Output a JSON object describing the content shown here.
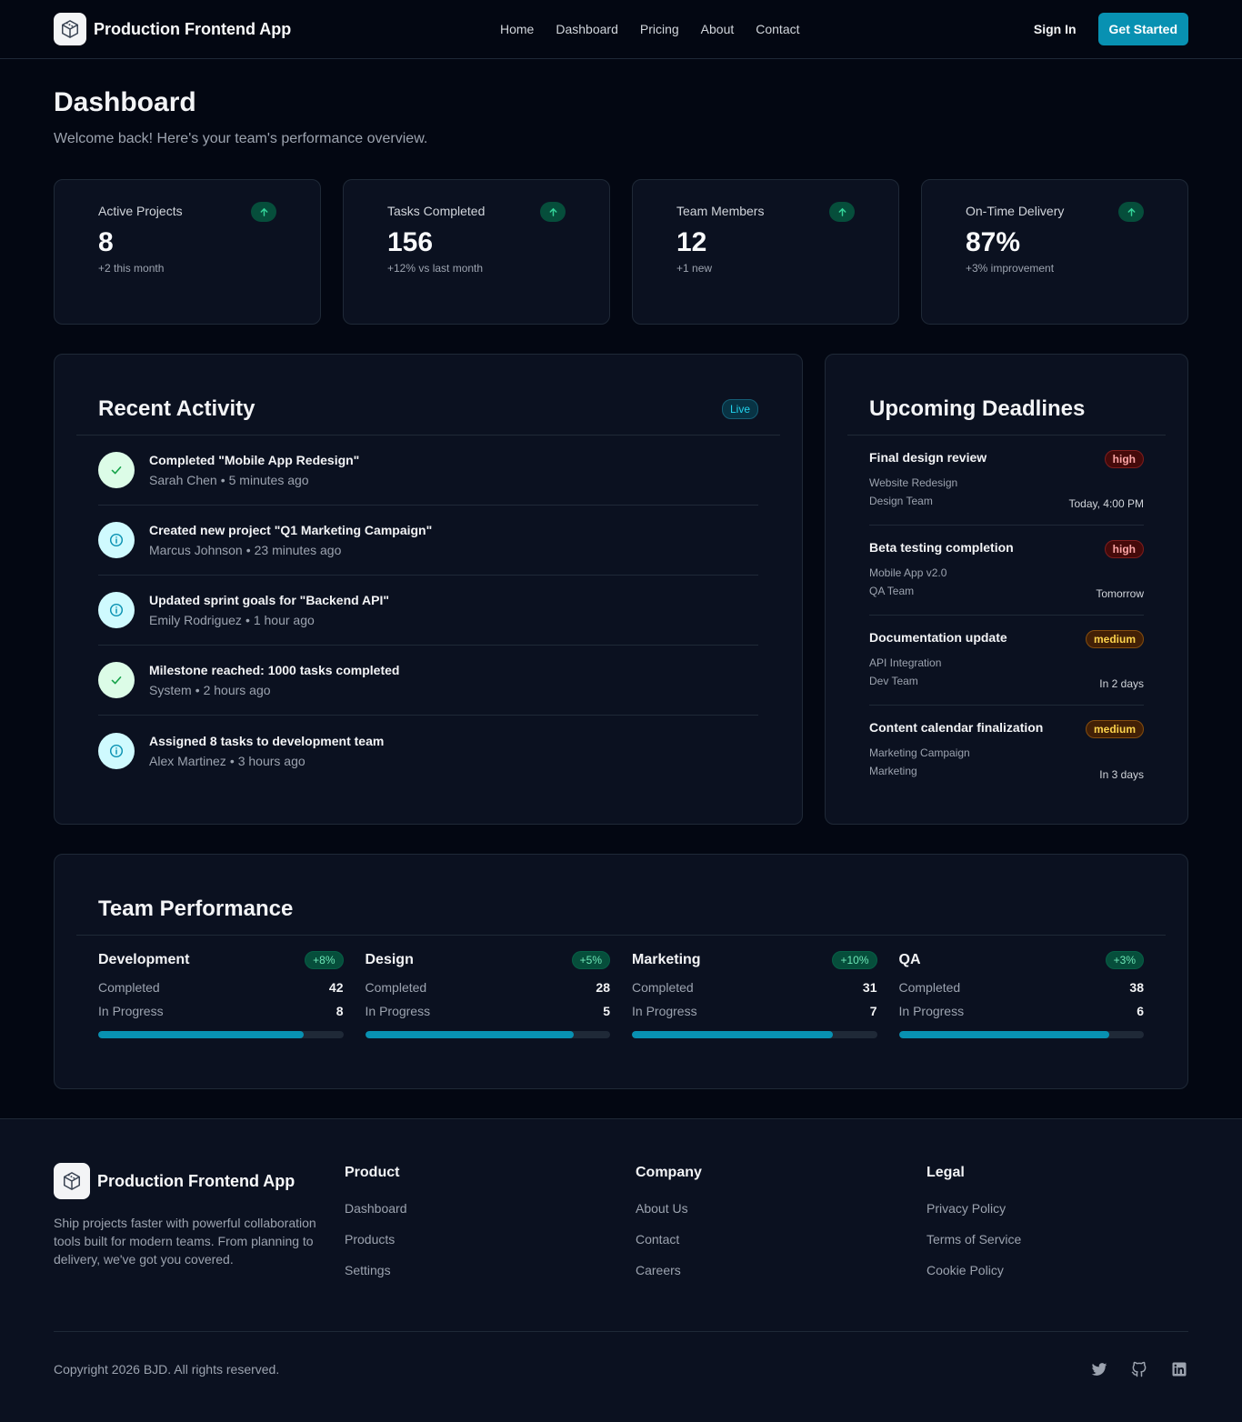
{
  "header": {
    "brand": "Production Frontend App",
    "nav": [
      "Home",
      "Dashboard",
      "Pricing",
      "About",
      "Contact"
    ],
    "sign_in": "Sign In",
    "get_started": "Get Started"
  },
  "page": {
    "title": "Dashboard",
    "subtitle": "Welcome back! Here's your team's performance overview."
  },
  "stats": [
    {
      "label": "Active Projects",
      "value": "8",
      "delta": "+2 this month",
      "icon": "arrow-up-icon"
    },
    {
      "label": "Tasks Completed",
      "value": "156",
      "delta": "+12% vs last month",
      "icon": "arrow-up-icon"
    },
    {
      "label": "Team Members",
      "value": "12",
      "delta": "+1 new",
      "icon": "arrow-up-icon"
    },
    {
      "label": "On-Time Delivery",
      "value": "87%",
      "delta": "+3% improvement",
      "icon": "arrow-up-icon"
    }
  ],
  "activity": {
    "title": "Recent Activity",
    "badge": "Live",
    "items": [
      {
        "title": "Completed \"Mobile App Redesign\"",
        "user": "Sarah Chen",
        "time": "5 minutes ago",
        "icon": "check-icon"
      },
      {
        "title": "Created new project \"Q1 Marketing Campaign\"",
        "user": "Marcus Johnson",
        "time": "23 minutes ago",
        "icon": "info-icon"
      },
      {
        "title": "Updated sprint goals for \"Backend API\"",
        "user": "Emily Rodriguez",
        "time": "1 hour ago",
        "icon": "info-icon"
      },
      {
        "title": "Milestone reached: 1000 tasks completed",
        "user": "System",
        "time": "2 hours ago",
        "icon": "check-icon"
      },
      {
        "title": "Assigned 8 tasks to development team",
        "user": "Alex Martinez",
        "time": "3 hours ago",
        "icon": "info-icon"
      }
    ]
  },
  "deadlines": {
    "title": "Upcoming Deadlines",
    "items": [
      {
        "title": "Final design review",
        "priority": "high",
        "project": "Website Redesign",
        "team": "Design Team",
        "due": "Today, 4:00 PM"
      },
      {
        "title": "Beta testing completion",
        "priority": "high",
        "project": "Mobile App v2.0",
        "team": "QA Team",
        "due": "Tomorrow"
      },
      {
        "title": "Documentation update",
        "priority": "medium",
        "project": "API Integration",
        "team": "Dev Team",
        "due": "In 2 days"
      },
      {
        "title": "Content calendar finalization",
        "priority": "medium",
        "project": "Marketing Campaign",
        "team": "Marketing",
        "due": "In 3 days"
      }
    ]
  },
  "performance": {
    "title": "Team Performance",
    "completed_label": "Completed",
    "in_progress_label": "In Progress",
    "teams": [
      {
        "name": "Development",
        "change": "+8%",
        "completed": "42",
        "in_progress": "8",
        "progress": 0.84
      },
      {
        "name": "Design",
        "change": "+5%",
        "completed": "28",
        "in_progress": "5",
        "progress": 0.85
      },
      {
        "name": "Marketing",
        "change": "+10%",
        "completed": "31",
        "in_progress": "7",
        "progress": 0.82
      },
      {
        "name": "QA",
        "change": "+3%",
        "completed": "38",
        "in_progress": "6",
        "progress": 0.86
      }
    ]
  },
  "footer": {
    "brand": "Production Frontend App",
    "description": "Ship projects faster with powerful collaboration tools built for modern teams. From planning to delivery, we've got you covered.",
    "columns": [
      {
        "title": "Product",
        "links": [
          "Dashboard",
          "Products",
          "Settings"
        ]
      },
      {
        "title": "Company",
        "links": [
          "About Us",
          "Contact",
          "Careers"
        ]
      },
      {
        "title": "Legal",
        "links": [
          "Privacy Policy",
          "Terms of Service",
          "Cookie Policy"
        ]
      }
    ],
    "copyright": "Copyright 2026 BJD. All rights reserved.",
    "socials": [
      "twitter-icon",
      "github-icon",
      "linkedin-icon"
    ]
  },
  "colors": {
    "accent": "#0891b2",
    "background": "#030712",
    "card": "#0b1120",
    "success": "#34d399"
  }
}
